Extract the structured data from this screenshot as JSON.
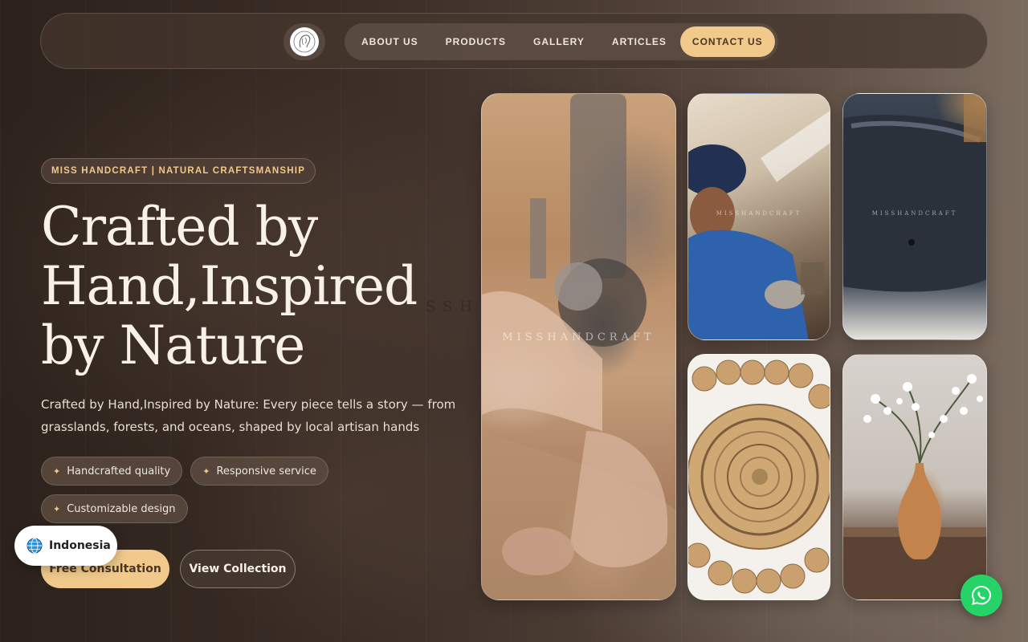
{
  "header": {
    "logo_alt": "Miss Handcraft logo",
    "nav": [
      "ABOUT US",
      "PRODUCTS",
      "GALLERY",
      "ARTICLES",
      "CONTACT US"
    ],
    "active_nav": "CONTACT US"
  },
  "hero": {
    "tag": "MISS HANDCRAFT | NATURAL CRAFTSMANSHIP",
    "headline_line1": "Crafted by",
    "headline_line2": "Hand,Inspired",
    "headline_line3": "by Nature",
    "subtext": "Crafted by Hand,Inspired by Nature: Every piece tells a story — from grasslands, forests, and oceans, shaped by local artisan hands",
    "chips": [
      "Handcrafted quality",
      "Responsive service",
      "Customizable design"
    ],
    "primary_button": "Free Consultation",
    "secondary_button": "View Collection"
  },
  "gallery": {
    "watermark_large": "MISSHANDCRAFT",
    "watermark_small": "MISSHANDCRAFT",
    "background_watermark": "SSH"
  },
  "language": {
    "label": "Indonesia",
    "icon": "globe-icon"
  },
  "whatsapp": {
    "icon": "whatsapp-icon"
  },
  "colors": {
    "accent": "#f0c98b",
    "whatsapp": "#25d366",
    "text_light": "#f7f1e8"
  }
}
